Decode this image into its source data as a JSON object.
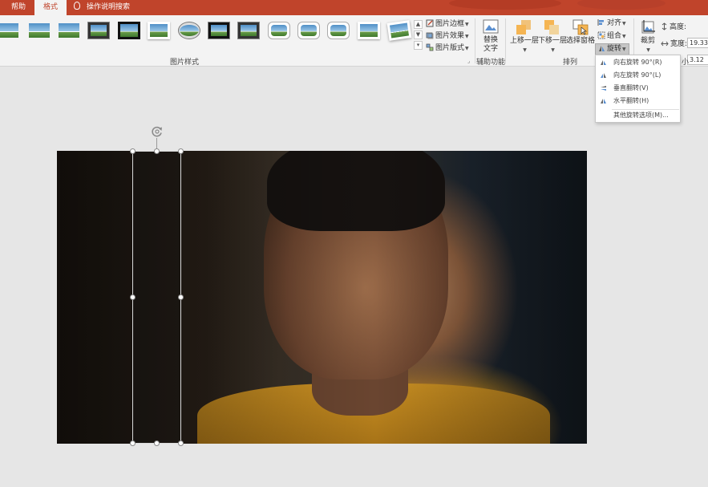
{
  "tabs": {
    "help": "帮助",
    "format": "格式",
    "search": "操作说明搜索"
  },
  "ribbon": {
    "picture_styles": {
      "label": "图片样式",
      "border": "图片边框",
      "effects": "图片效果",
      "layout": "图片版式"
    },
    "accessibility": {
      "label": "辅助功能",
      "alt_text_line1": "替换",
      "alt_text_line2": "文字"
    },
    "arrange": {
      "label": "排列",
      "bring_forward": "上移一层",
      "send_backward": "下移一层",
      "selection_pane": "选择窗格",
      "align": "对齐",
      "group": "组合",
      "rotate": "旋转"
    },
    "size": {
      "label_fragment": "小",
      "crop": "裁剪",
      "height_label": "高度:",
      "height_value": "19.33",
      "width_label": "宽度:",
      "width_value": "3.12"
    }
  },
  "rotate_menu": {
    "items": [
      {
        "label": "向右旋转 90°(R)"
      },
      {
        "label": "向左旋转 90°(L)"
      },
      {
        "label": "垂直翻转(V)"
      },
      {
        "label": "水平翻转(H)"
      },
      {
        "label": "其他旋转选项(M)..."
      }
    ]
  },
  "colors": {
    "accent": "#c0442b",
    "ribbon_bg": "#f3f3f3",
    "canvas_bg": "#e6e6e6"
  },
  "icons": {
    "search": "lightbulb-icon",
    "rotate_handle": "rotate-arrow-icon"
  }
}
